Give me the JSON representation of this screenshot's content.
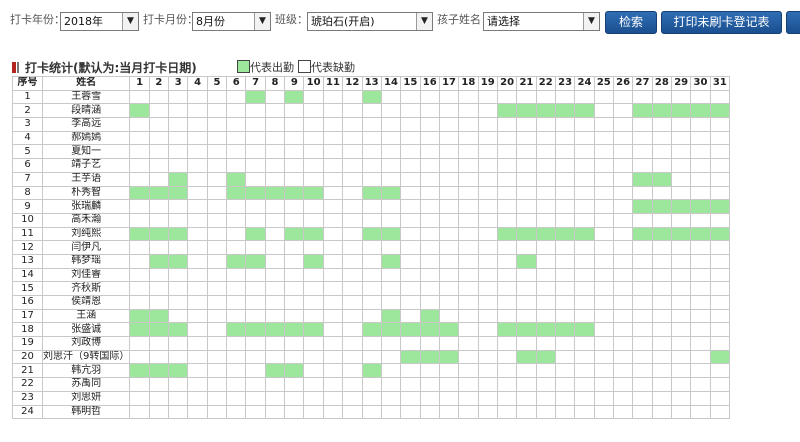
{
  "filters": {
    "year_label": "打卡年份：",
    "year_value": "2018年",
    "month_label": "打卡月份：",
    "month_value": "8月份",
    "class_label": "班级：",
    "class_value": "琥珀石(开启)",
    "child_label": "孩子姓名：",
    "child_value": "请选择"
  },
  "buttons": {
    "search": "检索",
    "print": "打印未刷卡登记表"
  },
  "section": {
    "title": "打卡统计(默认为:当月打卡日期)",
    "legend_present": "代表出勤",
    "legend_absent": "代表缺勤"
  },
  "colors": {
    "present": "#9de79d",
    "absent": "#ffffff",
    "button": "#1f5aa0"
  },
  "table": {
    "col_index": "序号",
    "col_name": "姓名",
    "days": [
      "1",
      "2",
      "3",
      "4",
      "5",
      "6",
      "7",
      "8",
      "9",
      "10",
      "11",
      "12",
      "13",
      "14",
      "15",
      "16",
      "17",
      "18",
      "19",
      "20",
      "21",
      "22",
      "23",
      "24",
      "25",
      "26",
      "27",
      "28",
      "29",
      "30",
      "31"
    ],
    "rows": [
      {
        "no": "1",
        "name": "王蓉雪",
        "present": [
          7,
          9,
          13
        ]
      },
      {
        "no": "2",
        "name": "段晴涵",
        "present": [
          1,
          20,
          21,
          22,
          23,
          24,
          27,
          28,
          29,
          30,
          31
        ]
      },
      {
        "no": "3",
        "name": "李高远",
        "present": []
      },
      {
        "no": "4",
        "name": "郝嫣嫣",
        "present": []
      },
      {
        "no": "5",
        "name": "夏知一",
        "present": []
      },
      {
        "no": "6",
        "name": "靖子艺",
        "present": []
      },
      {
        "no": "7",
        "name": "王芋语",
        "present": [
          3,
          6,
          27,
          28
        ]
      },
      {
        "no": "8",
        "name": "朴秀智",
        "present": [
          1,
          2,
          3,
          6,
          7,
          8,
          9,
          10,
          13,
          14
        ]
      },
      {
        "no": "9",
        "name": "张瑞麟",
        "present": [
          27,
          28,
          29,
          30,
          31
        ]
      },
      {
        "no": "10",
        "name": "高禾瀚",
        "present": []
      },
      {
        "no": "11",
        "name": "刘纯熙",
        "present": [
          1,
          2,
          3,
          7,
          9,
          10,
          13,
          14,
          20,
          21,
          22,
          23,
          24,
          27,
          28,
          29,
          30,
          31
        ]
      },
      {
        "no": "12",
        "name": "闫伊凡",
        "present": []
      },
      {
        "no": "13",
        "name": "韩梦瑶",
        "present": [
          2,
          3,
          6,
          7,
          10,
          14,
          21
        ]
      },
      {
        "no": "14",
        "name": "刘佳睿",
        "present": []
      },
      {
        "no": "15",
        "name": "齐秋斯",
        "present": []
      },
      {
        "no": "16",
        "name": "侯靖恩",
        "present": []
      },
      {
        "no": "17",
        "name": "王涵",
        "present": [
          1,
          2,
          14,
          16
        ]
      },
      {
        "no": "18",
        "name": "张盛诚",
        "present": [
          1,
          2,
          3,
          6,
          7,
          8,
          9,
          10,
          13,
          14,
          15,
          16,
          17,
          20,
          21,
          22,
          23,
          24
        ]
      },
      {
        "no": "19",
        "name": "刘政博",
        "present": []
      },
      {
        "no": "20",
        "name": "刘思汗（9转国际）",
        "present": [
          15,
          16,
          17,
          21,
          22,
          31
        ]
      },
      {
        "no": "21",
        "name": "韩亢羽",
        "present": [
          1,
          2,
          3,
          8,
          9,
          13
        ]
      },
      {
        "no": "22",
        "name": "苏禹同",
        "present": []
      },
      {
        "no": "23",
        "name": "刘思妍",
        "present": []
      },
      {
        "no": "24",
        "name": "韩明哲",
        "present": []
      }
    ]
  }
}
